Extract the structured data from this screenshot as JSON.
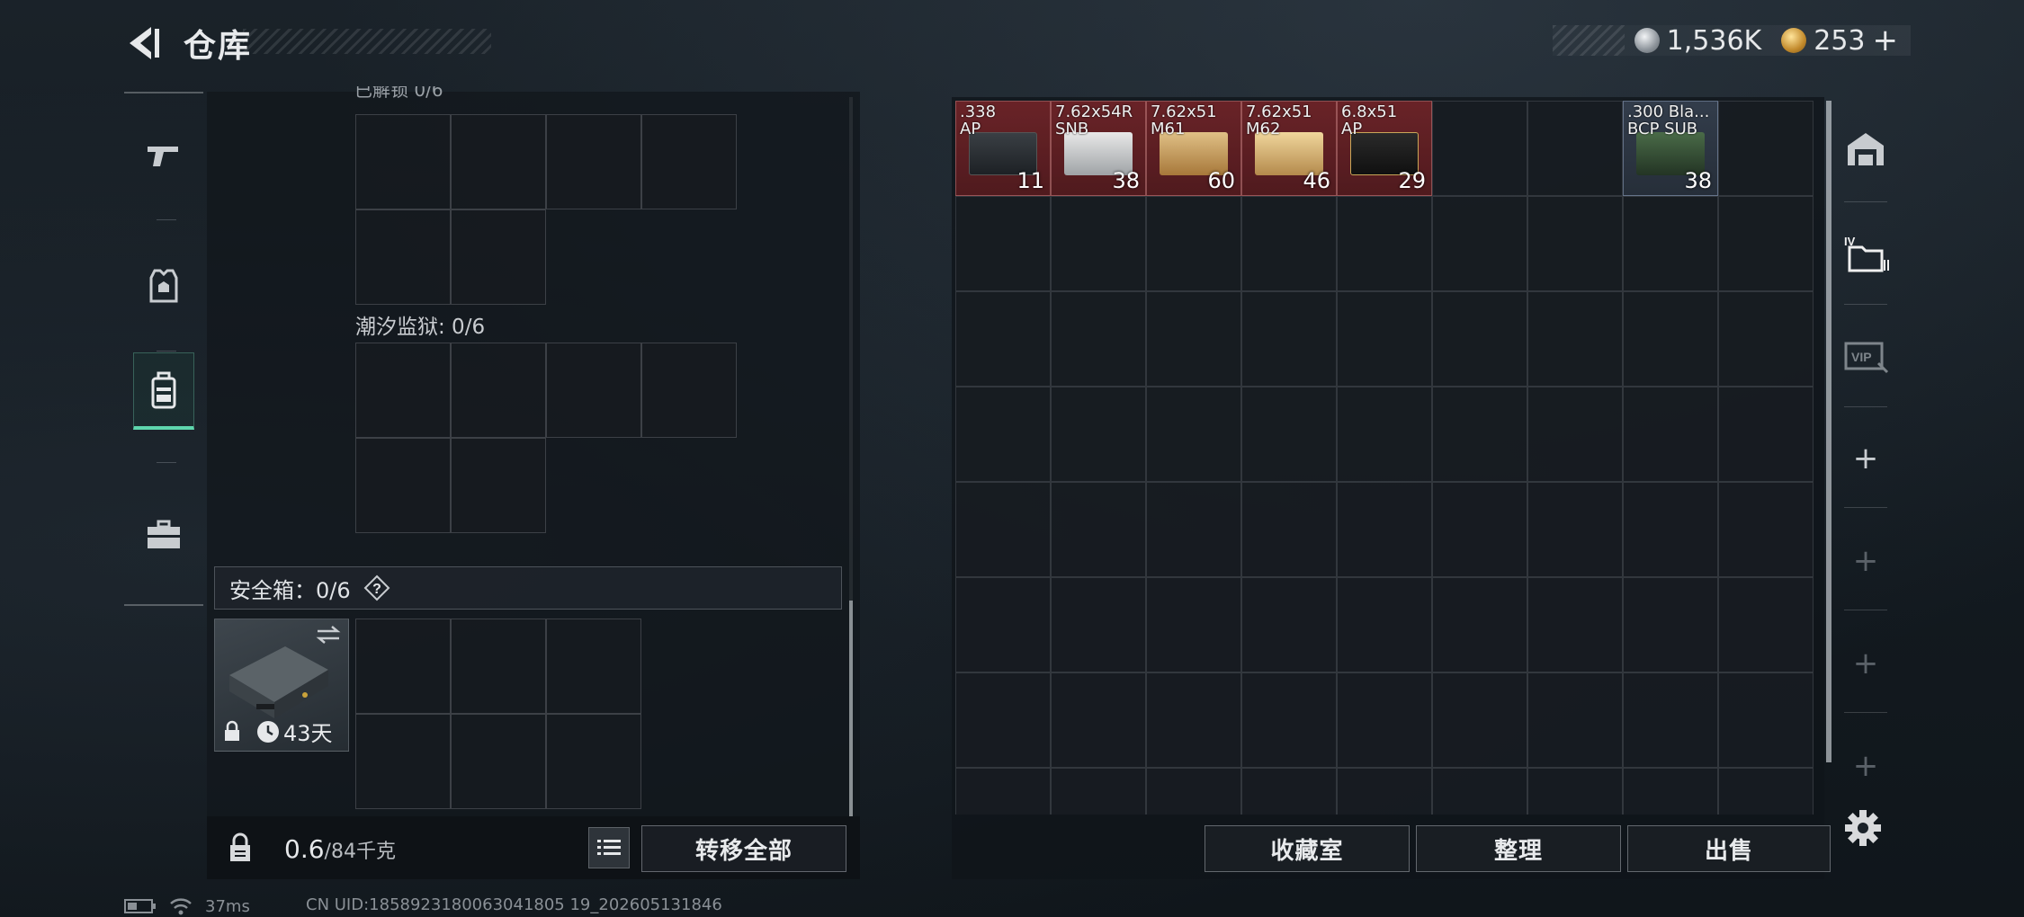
{
  "header": {
    "title": "仓库"
  },
  "currency": {
    "silver": "1,536K",
    "gold": "253",
    "add": "+"
  },
  "left": {
    "top_cut_label": "已解锁 0/6",
    "tide_prison_label": "潮汐监狱: 0/6",
    "safebox_label": "安全箱：0/6",
    "case_days": "43天",
    "weight_value": "0.6",
    "weight_capacity": "/84千克",
    "transfer_all": "转移全部"
  },
  "ammo": [
    {
      "name": ".338\nAP",
      "qty": "11",
      "style": "dark"
    },
    {
      "name": "7.62x54R\nSNB",
      "qty": "38",
      "style": "white"
    },
    {
      "name": "7.62x51\nM61",
      "qty": "60",
      "style": "tan"
    },
    {
      "name": "7.62x51\nM62",
      "qty": "46",
      "style": "tan2"
    },
    {
      "name": "6.8x51\nAP",
      "qty": "29",
      "style": "black"
    },
    {
      "name": ".300 Bla...\nBCP SUB",
      "qty": "38",
      "style": "green"
    }
  ],
  "right": {
    "collection_room": "收藏室",
    "organize": "整理",
    "sell": "出售"
  },
  "status": {
    "ping": "37ms",
    "uid": "CN UID:1858923180063041805 19_202605131846"
  },
  "colors": {
    "accent": "#5ed6ad",
    "ammo_red": "#7a2428",
    "panel": "#12171c"
  }
}
